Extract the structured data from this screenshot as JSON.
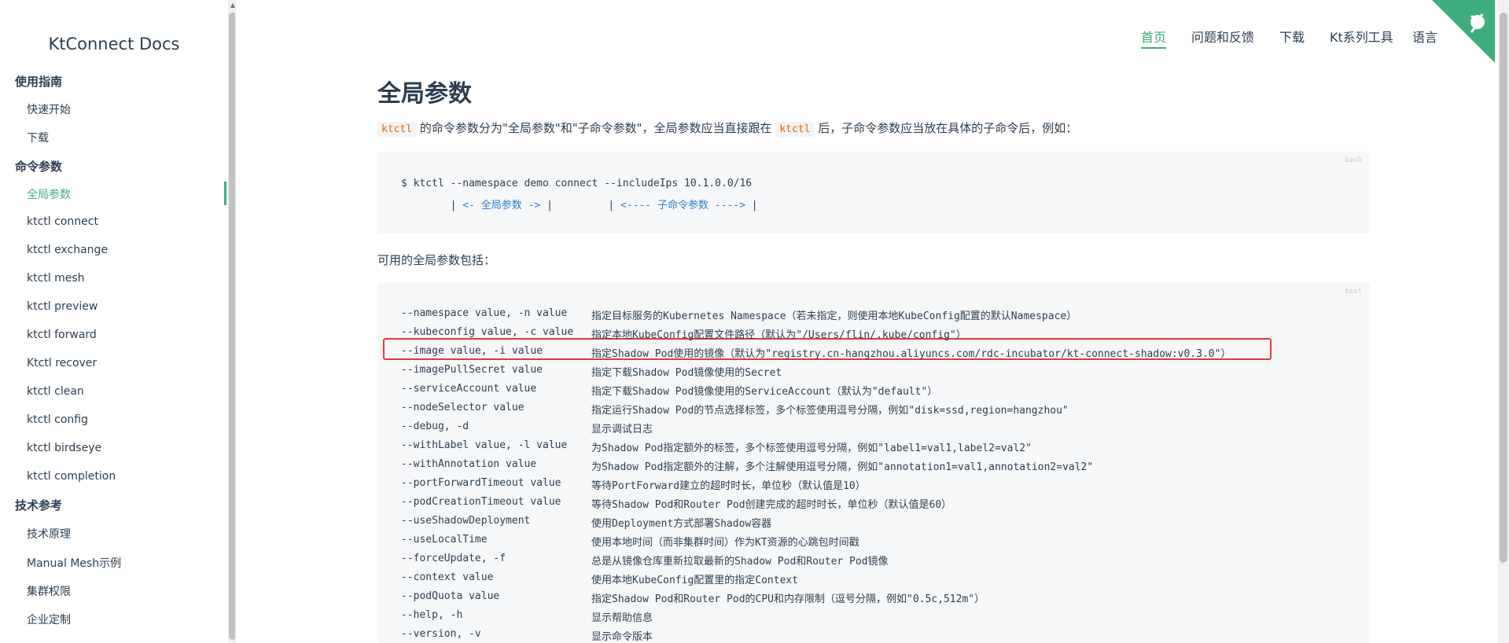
{
  "sidebar": {
    "title": "KtConnect Docs",
    "groups": [
      {
        "label": "使用指南"
      },
      {
        "label": "命令参数"
      },
      {
        "label": "技术参考"
      }
    ],
    "items": [
      {
        "label": "快速开始"
      },
      {
        "label": "下载"
      },
      {
        "label": "全局参数"
      },
      {
        "label": "ktctl connect"
      },
      {
        "label": "ktctl exchange"
      },
      {
        "label": "ktctl mesh"
      },
      {
        "label": "ktctl preview"
      },
      {
        "label": "ktctl forward"
      },
      {
        "label": "Ktctl recover"
      },
      {
        "label": "ktctl clean"
      },
      {
        "label": "ktctl config"
      },
      {
        "label": "ktctl birdseye"
      },
      {
        "label": "ktctl completion"
      },
      {
        "label": "技术原理"
      },
      {
        "label": "Manual Mesh示例"
      },
      {
        "label": "集群权限"
      },
      {
        "label": "企业定制"
      }
    ]
  },
  "topnav": {
    "items": [
      {
        "label": "首页"
      },
      {
        "label": "问题和反馈"
      },
      {
        "label": "下载"
      },
      {
        "label": "Kt系列工具"
      },
      {
        "label": "语言"
      }
    ]
  },
  "content": {
    "title": "全局参数",
    "intro_code": "ktctl",
    "intro_part1": "的命令参数分为\"全局参数\"和\"子命令参数\"，全局参数应当直接跟在",
    "intro_part2": "后，子命令参数应当放在具体的子命令后，例如：",
    "bash_lang": "bash",
    "bash_line1": "$ ktctl --namespace demo connect --includeIps 10.1.0.0/16",
    "bash_line2_a": "        | ",
    "bash_line2_b": "<- 全局参数 ->",
    "bash_line2_c": " |         | ",
    "bash_line2_d": "<---- 子命令参数 ---->",
    "bash_line2_e": " |",
    "params_intro": "可用的全局参数包括：",
    "text_lang": "text",
    "params": [
      {
        "opt": "--namespace value, -n value",
        "desc": "指定目标服务的Kubernetes Namespace（若未指定，则使用本地KubeConfig配置的默认Namespace）"
      },
      {
        "opt": "--kubeconfig value, -c value",
        "desc": "指定本地KubeConfig配置文件路径（默认为\"/Users/flin/.kube/config\"）"
      },
      {
        "opt": "--image value, -i value",
        "desc": "指定Shadow Pod使用的镜像（默认为\"registry.cn-hangzhou.aliyuncs.com/rdc-incubator/kt-connect-shadow:v0.3.0\"）"
      },
      {
        "opt": "--imagePullSecret value",
        "desc": "指定下载Shadow Pod镜像使用的Secret"
      },
      {
        "opt": "--serviceAccount value",
        "desc": "指定下载Shadow Pod镜像使用的ServiceAccount（默认为\"default\"）"
      },
      {
        "opt": "--nodeSelector value",
        "desc": "指定运行Shadow Pod的节点选择标签，多个标签使用逗号分隔，例如\"disk=ssd,region=hangzhou\""
      },
      {
        "opt": "--debug, -d",
        "desc": "显示调试日志"
      },
      {
        "opt": "--withLabel value, -l value",
        "desc": "为Shadow Pod指定额外的标签，多个标签使用逗号分隔，例如\"label1=val1,label2=val2\""
      },
      {
        "opt": "--withAnnotation value",
        "desc": "为Shadow Pod指定额外的注解，多个注解使用逗号分隔，例如\"annotation1=val1,annotation2=val2\""
      },
      {
        "opt": "--portForwardTimeout value",
        "desc": "等待PortForward建立的超时时长，单位秒（默认值是10）"
      },
      {
        "opt": "--podCreationTimeout value",
        "desc": "等待Shadow Pod和Router Pod创建完成的超时时长，单位秒（默认值是60）"
      },
      {
        "opt": "--useShadowDeployment",
        "desc": "使用Deployment方式部署Shadow容器"
      },
      {
        "opt": "--useLocalTime",
        "desc": "使用本地时间（而非集群时间）作为KT资源的心跳包时间戳"
      },
      {
        "opt": "--forceUpdate, -f",
        "desc": "总是从镜像仓库重新拉取最新的Shadow Pod和Router Pod镜像"
      },
      {
        "opt": "--context value",
        "desc": "使用本地KubeConfig配置里的指定Context"
      },
      {
        "opt": "--podQuota value",
        "desc": "指定Shadow Pod和Router Pod的CPU和内存限制（逗号分隔，例如\"0.5c,512m\"）"
      },
      {
        "opt": "--help, -h",
        "desc": "显示帮助信息"
      },
      {
        "opt": "--version, -v",
        "desc": "显示命令版本"
      }
    ]
  },
  "colors": {
    "accent": "#3eaf7c",
    "highlight": "#e03a3a",
    "inline_code": "#e96900"
  }
}
